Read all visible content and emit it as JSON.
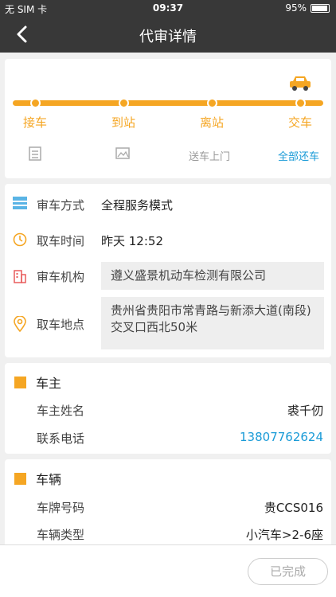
{
  "status": {
    "carrier": "无 SIM 卡",
    "time": "09:37",
    "battery": "95%",
    "battery_level": 0.95
  },
  "nav": {
    "title": "代审详情"
  },
  "progress": {
    "steps": [
      "接车",
      "到站",
      "离站",
      "交车"
    ],
    "current_step": 4,
    "tools": {
      "delivery": "送车上门",
      "return_all": "全部还车"
    },
    "accent": "#f5a623"
  },
  "info": {
    "method_label": "审车方式",
    "method_value": "全程服务模式",
    "pickup_time_label": "取车时间",
    "pickup_time_value": "昨天  12:52",
    "agency_label": "审车机构",
    "agency_value": "遵义盛景机动车检测有限公司",
    "location_label": "取车地点",
    "location_value": "贵州省贵阳市常青路与新添大道(南段)交叉口西北50米"
  },
  "owner": {
    "title": "车主",
    "name_label": "车主姓名",
    "name_value": "裘千仞",
    "phone_label": "联系电话",
    "phone_value": "13807762624"
  },
  "vehicle": {
    "title": "车辆",
    "plate_label": "车牌号码",
    "plate_value": "贵CCS016",
    "type_label": "车辆类型",
    "type_value": "小汽车>2-6座"
  },
  "footer": {
    "done_label": "已完成"
  },
  "colors": {
    "link": "#1a9bd7",
    "accent": "#f5a623",
    "navbar": "#383838"
  }
}
